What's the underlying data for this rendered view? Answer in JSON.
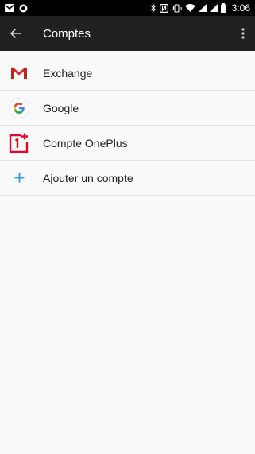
{
  "status_bar": {
    "time": "3:06",
    "icons": [
      "gmail-notification-icon",
      "record-icon",
      "bluetooth-icon",
      "nfc-icon",
      "vibrate-icon",
      "wifi-icon",
      "signal-icon",
      "signal-icon",
      "battery-icon"
    ]
  },
  "toolbar": {
    "title": "Comptes",
    "back_icon": "arrow-back-icon",
    "overflow_icon": "more-vert-icon"
  },
  "accounts": [
    {
      "label": "Exchange",
      "icon": "gmail-icon"
    },
    {
      "label": "Google",
      "icon": "google-icon"
    },
    {
      "label": "Compte OnePlus",
      "icon": "oneplus-icon"
    },
    {
      "label": "Ajouter un compte",
      "icon": "add-icon"
    }
  ],
  "colors": {
    "toolbar_bg": "#212121",
    "status_bg": "#000000",
    "page_bg": "#fafafa",
    "oneplus_red": "#eb0029",
    "add_blue": "#2b9bd6"
  }
}
